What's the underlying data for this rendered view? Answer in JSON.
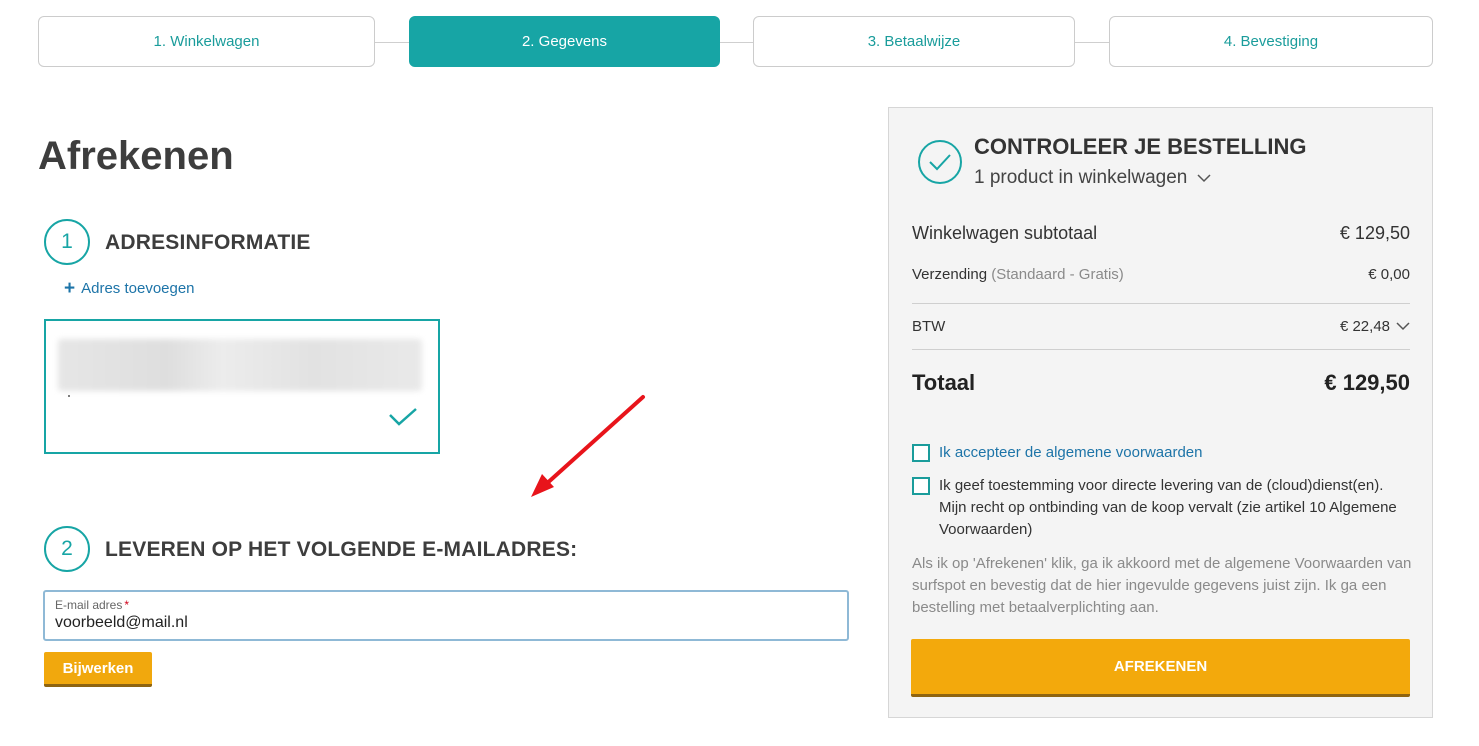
{
  "steps": [
    {
      "label": "1. Winkelwagen",
      "active": false
    },
    {
      "label": "2. Gegevens",
      "active": true
    },
    {
      "label": "3. Betaalwijze",
      "active": false
    },
    {
      "label": "4. Bevestiging",
      "active": false
    }
  ],
  "page_title": "Afrekenen",
  "address_section": {
    "number": "1",
    "title": "ADRESINFORMATIE",
    "add_link_icon": "plus-icon",
    "add_link": "Adres toevoegen",
    "selected_icon": "check-icon"
  },
  "annotation": {
    "icon": "red-arrow-icon",
    "color": "#e8141b"
  },
  "email_section": {
    "number": "2",
    "title": "LEVEREN OP HET VOLGENDE E-MAILADRES:",
    "field_label": "E-mail adres",
    "required_mark": "*",
    "field_value": "voorbeeld@mail.nl",
    "update_button": "Bijwerken"
  },
  "summary": {
    "check_icon": "check-circle-icon",
    "title": "CONTROLEER JE BESTELLING",
    "subtitle": "1 product in winkelwagen",
    "subtitle_icon": "chevron-down-icon",
    "subtotal_label": "Winkelwagen subtotaal",
    "subtotal_value": "€ 129,50",
    "shipping_label": "Verzending",
    "shipping_detail": "(Standaard - Gratis)",
    "shipping_value": "€ 0,00",
    "btw_label": "BTW",
    "btw_value": "€ 22,48",
    "btw_icon": "chevron-down-icon",
    "total_label": "Totaal",
    "total_value": "€ 129,50",
    "terms_checkbox": "Ik accepteer de algemene voorwaarden",
    "consent_checkbox": "Ik geef toestemming voor directe levering van de (cloud)dienst(en). Mijn recht op ontbinding van de koop vervalt (zie artikel 10 Algemene Voorwaarden)",
    "disclaimer": "Als ik op 'Afrekenen' klik, ga ik akkoord met de algemene Voorwaarden van surfspot en bevestig dat de hier ingevulde gegevens juist zijn. Ik ga een bestelling met betaalverplichting aan.",
    "checkout_button": "AFREKENEN"
  },
  "colors": {
    "teal": "#17a5a5",
    "link_blue": "#1d74a8",
    "button_orange": "#f3a90c",
    "panel_bg": "#f4f4f4"
  }
}
